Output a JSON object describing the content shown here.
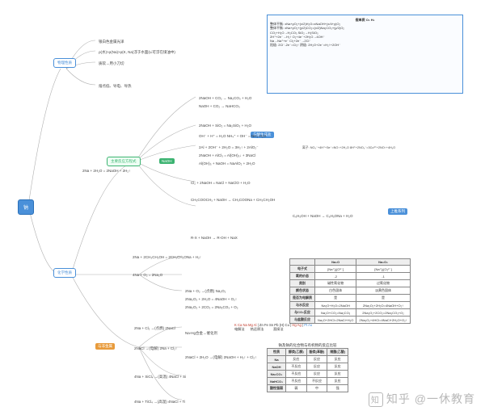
{
  "root": "钠",
  "branches": {
    "physical": {
      "title": "物理性质",
      "items": [
        "银白色金属光泽",
        "ρ(水)>ρ(Na)>ρ(K, Na)浮于水面(Li可浮在煤油中)",
        "质软→用小刀切",
        "熔点低、导电、导热"
      ]
    },
    "chemistry": "化学性质"
  },
  "center_label": "主要反应方程式",
  "naoh_tag": "NaOH",
  "ion_tag": "与酸生成盐",
  "cl_tag": "与非金属",
  "series_tag": "上推系列",
  "equations": {
    "water": "2Na + 2H₂O = 2NaOH + 2H₂↑",
    "co2": "2NaOH + CO₂ → Na₂CO₃ + H₂O",
    "co2_2": "NaOH + CO₂ → NaHCO₃",
    "sio2": "2NaOH + SiO₂ = Na₂SiO₃ + H₂O",
    "ion1": "OH⁻ + H⁺ = H₂O  NH₄⁺ + OH⁻ = NH₃·H₂O",
    "al": "2Al + 2OH⁻ + 2H₂O = 3H₂↑ + 2AlO₂⁻",
    "alcl3": "2NaOH + AlCl₃ = Al(OH)₃↓ + 3NaCl",
    "naalo2": "Al(OH)₃ + NaOH = NaAlO₂ + 2H₂O",
    "cl2": "Cl₂ + 2NaOH = NaCl + NaClO + H₂O",
    "nano3": "离子: NO₃⁻+4H⁺+3e⁻=NO↑+2H₂O  8H⁺+2NO₃⁻=3Cu²⁺+2NO↑+4H₂O",
    "ester": "CH₃COOCH₃ + NaOH → CH₃COONa + CH₃CH₂OH",
    "phenol": "C₆H₅OH + NaOH → C₆H₅ONa + H₂O",
    "halide": "R-X + NaOH → R-OH + NaX",
    "alcohol": "2Na + 2CH₃CH₂OH = 2CH₃CH₂ONa + H₂↑",
    "o2_1": "4Na + O₂ = 2Na₂O",
    "o2_2": "2Na + O₂ →(点燃) Na₂O₂",
    "nacl1": "2Na + Cl₂ →(点燃) 2NaCl",
    "nacl_elec": "2NaCl →(电解) 2Na + Cl₂↑",
    "nacl_aq": "2NaCl + 2H₂O →(电解) 2NaOH + H₂↑ + Cl₂↑",
    "sicl4": "4Na + SiCl₄ →(高温) 4NaCl + Si",
    "ticl4": "4Na + TiCl₄ →(高温) 4NaCl + Ti",
    "hg": "Na-Hg合金→催化剂",
    "n2o2_h2o": "2Na₂O₂ + 2H₂O = 4NaOH + O₂↑",
    "n2o2_co2": "2Na₂O₂ + 2CO₂ = 2Na₂CO₃ + O₂"
  },
  "oxide_table": {
    "headers": [
      "",
      "Na₂O",
      "Na₂O₂"
    ],
    "rows": [
      [
        "电子式",
        "[Na⁺]₂[O²⁻]",
        "[Na⁺]₂[O₂²⁻]"
      ],
      [
        "氧的价态",
        "-2",
        "-1"
      ],
      [
        "类别",
        "碱性氧化物",
        "过氧化物"
      ],
      [
        "颜色状态",
        "白色固体",
        "淡黄色固体"
      ],
      [
        "是否为电解质",
        "是",
        "是"
      ],
      [
        "与水反应",
        "Na₂O+H₂O=2NaOH",
        "2Na₂O₂+2H₂O=4NaOH+O₂↑"
      ],
      [
        "与CO₂反应",
        "Na₂O+CO₂=Na₂CO₃",
        "2Na₂O₂+2CO₂=2Na₂CO₃+O₂"
      ],
      [
        "与盐酸反应",
        "Na₂O+2HCl=2NaCl+H₂O",
        "2Na₂O₂+4HCl=4NaCl+2H₂O+O₂↑"
      ]
    ]
  },
  "activity": {
    "label": "金属活动性顺序",
    "series": [
      "K Ca Na Mg Al",
      "Zn Fe Sn Pb (H) Cu",
      "Hg Ag",
      "Pt Au"
    ],
    "methods": [
      "电解法",
      "热还原法",
      "",
      "直接法"
    ]
  },
  "compare_table": {
    "title": "钠及钠的化合物与有机物的反应比较",
    "headers": [
      "性质",
      "醇类(乙醇)",
      "酚类(苯酚)",
      "羧酸(乙酸)"
    ],
    "rows": [
      [
        "Na",
        "反应",
        "反应",
        "反应"
      ],
      [
        "NaOH",
        "不反应",
        "反应",
        "反应"
      ],
      [
        "Na₂CO₃",
        "不反应",
        "反应",
        "反应"
      ],
      [
        "NaHCO₃",
        "不反应",
        "不反应",
        "反应"
      ],
      [
        "酸性强弱",
        "弱",
        "中",
        "强"
      ]
    ]
  },
  "top_panel": {
    "title": "假单质 O₂ H₂",
    "lines": [
      "整体平衡: xNa+yO₂+(x/2)H₂O=xNaOH+(x/4+y)O₂",
      "整体平衡: xNa+yO₂+(y/2)CO₂=(x/2)Na₂CO₃+(y/2)O₂",
      "CO₂+H₂O→H₂CO₃  SiO₂→H₂SiO₃",
      "2H⁺+2e⁻→H₂↑  O₂+4e⁻+2H₂O→4OH⁻",
      "Na→Na⁺+e⁻  Cl₂+2e⁻→2Cl⁻",
      "阳极: 2Cl⁻-2e⁻=Cl₂↑ 阴极: 2H₂O+2e⁻=H₂↑+2OH⁻"
    ]
  },
  "watermark": "知乎 @一休教育"
}
